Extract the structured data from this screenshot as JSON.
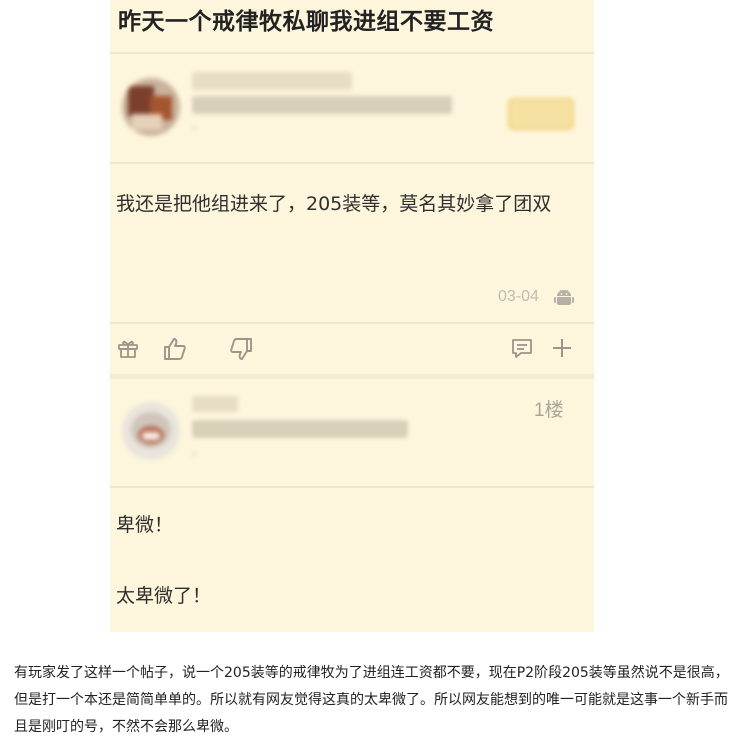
{
  "post": {
    "title": "昨天一个戒律牧私聊我进组不要工资",
    "content": "我还是把他组进来了，205装等，莫名其妙拿了团双",
    "date": "03-04",
    "device_icon": "android-icon",
    "actions": [
      "gift-icon",
      "like-icon",
      "dislike-icon",
      "comment-icon",
      "plus-icon"
    ]
  },
  "reply": {
    "floor": "1楼",
    "line1": "卑微！",
    "line2": "太卑微了！"
  },
  "caption": "有玩家发了这样一个帖子，说一个205装等的戒律牧为了进组连工资都不要，现在P2阶段205装等虽然说不是很高，但是打一个本还是简简单单的。所以就有网友觉得这真的太卑微了。所以网友能想到的唯一可能就是这事一个新手而且是刚叮的号，不然不会那么卑微。",
  "colors": {
    "panel_bg": "#fdf6dc",
    "meta_text": "#c2bcae",
    "icon_stroke": "#9b958a"
  }
}
